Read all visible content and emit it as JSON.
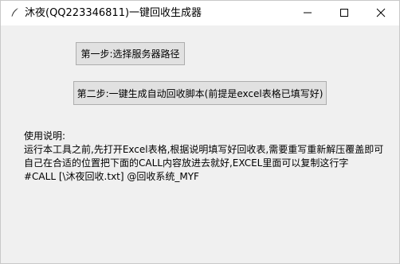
{
  "window": {
    "title": "沐夜(QQ223346811)一键回收生成器",
    "app_icon": "feather-icon",
    "controls": {
      "minimize_icon": "minimize-icon",
      "maximize_icon": "maximize-icon",
      "close_icon": "close-icon"
    }
  },
  "buttons": {
    "step1_label": "第一步:选择服务器路径",
    "step2_label": "第二步:一键生成自动回收脚本(前提是excel表格已填写好)"
  },
  "usage": {
    "heading": "使用说明:",
    "lines": [
      "运行本工具之前,先打开Excel表格,根据说明填写好回收表,需要重写重新解压覆盖即可",
      "自己在合适的位置把下面的CALL内容放进去就好,EXCEL里面可以复制这行字",
      "#CALL [\\沐夜回收.txt] @回收系统_MYF"
    ]
  },
  "colors": {
    "background": "#f0f0f0",
    "titlebar": "#ffffff",
    "button_face": "#e1e1e1",
    "button_border": "#adadad"
  }
}
